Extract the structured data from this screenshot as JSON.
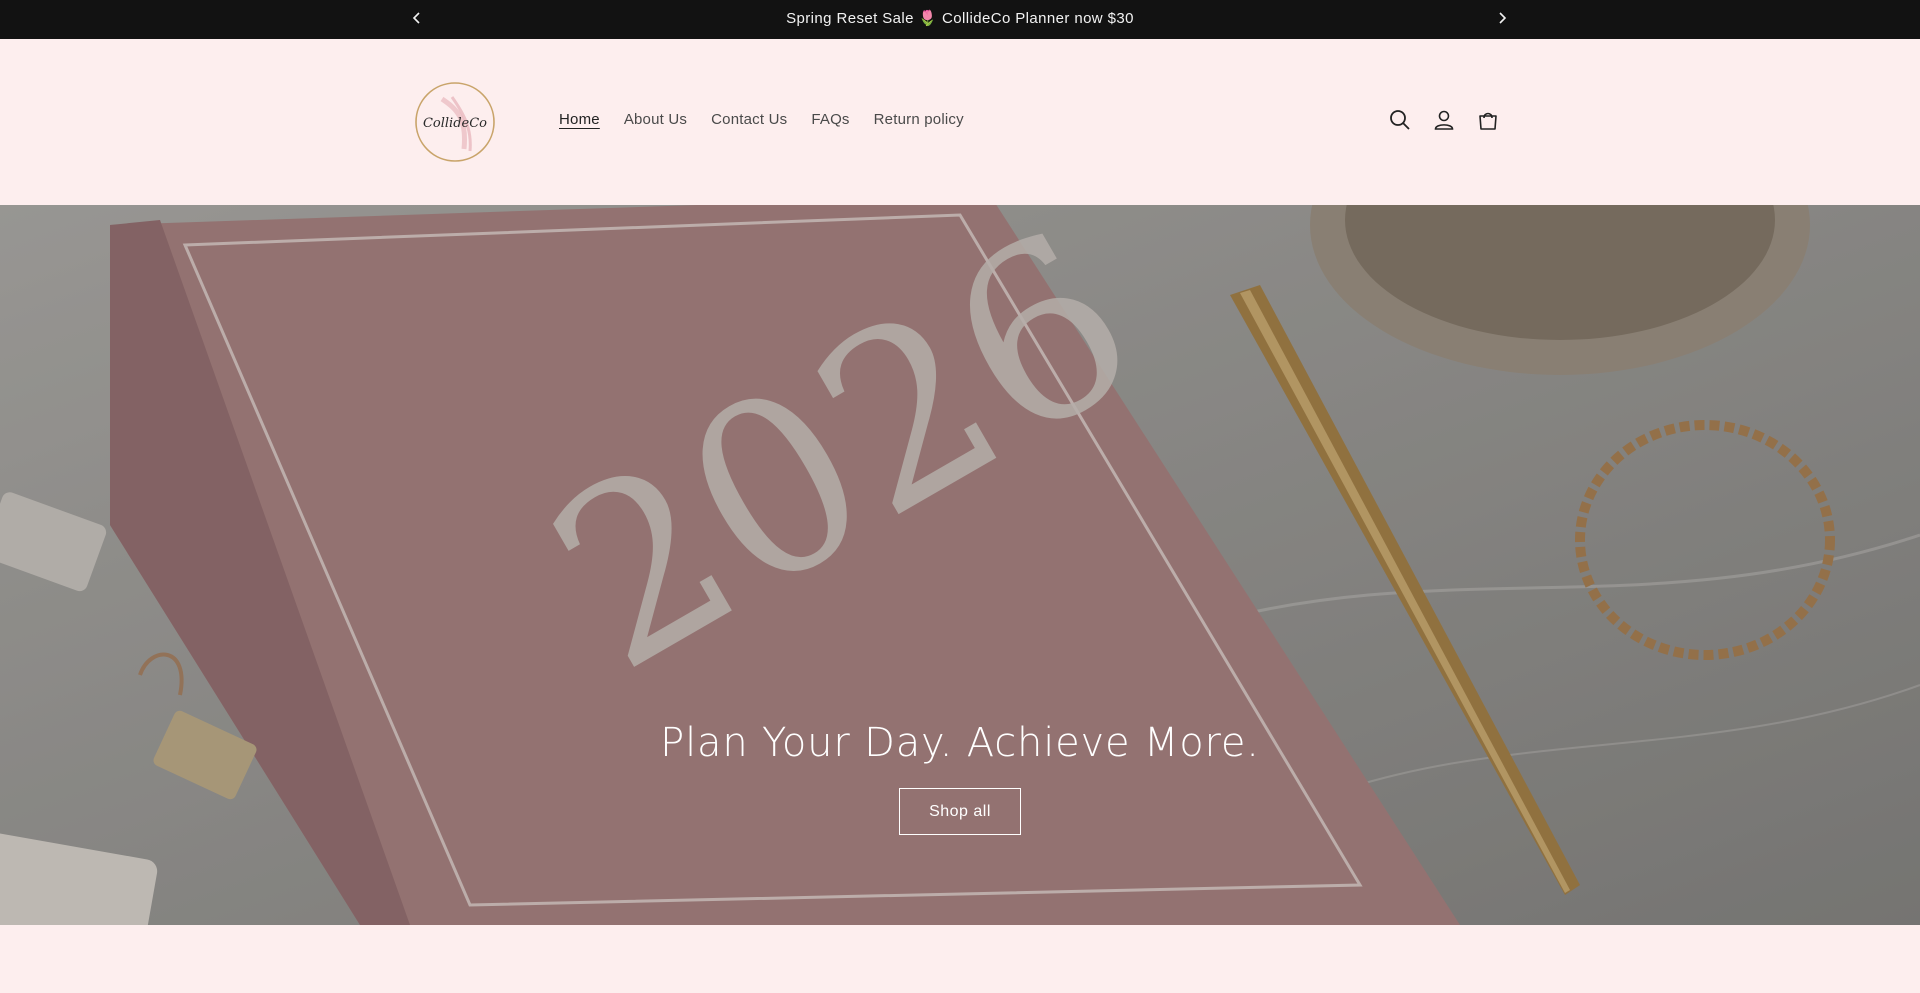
{
  "announcement": {
    "text": "Spring Reset Sale 🌷 CollideCo Planner now $30",
    "prev_icon": "chevron-left-icon",
    "next_icon": "chevron-right-icon"
  },
  "header": {
    "logo_text": "CollideCo",
    "nav": [
      {
        "label": "Home",
        "active": true
      },
      {
        "label": "About Us",
        "active": false
      },
      {
        "label": "Contact Us",
        "active": false
      },
      {
        "label": "FAQs",
        "active": false
      },
      {
        "label": "Return policy",
        "active": false
      }
    ],
    "icons": [
      "search-icon",
      "account-icon",
      "cart-icon"
    ]
  },
  "hero": {
    "title": "Plan Your Day. Achieve More.",
    "button_label": "Shop all",
    "planner_year": "2026"
  },
  "colors": {
    "announcement_bg": "#121212",
    "page_bg": "#fdeeee",
    "planner_pink": "#b48c8a",
    "gold": "#c9a46a"
  }
}
